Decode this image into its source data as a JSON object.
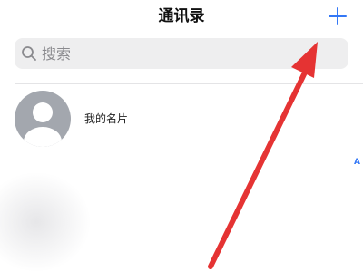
{
  "header": {
    "title": "通讯录",
    "add_icon": "plus-icon",
    "accent_color": "#3478f6"
  },
  "search": {
    "icon": "search-icon",
    "placeholder": "搜索",
    "value": ""
  },
  "my_card": {
    "avatar_icon": "person-silhouette-icon",
    "label": "我的名片"
  },
  "index": {
    "letters": [
      "A"
    ]
  },
  "annotation": {
    "icon": "red-arrow-icon",
    "color": "#e53333"
  }
}
